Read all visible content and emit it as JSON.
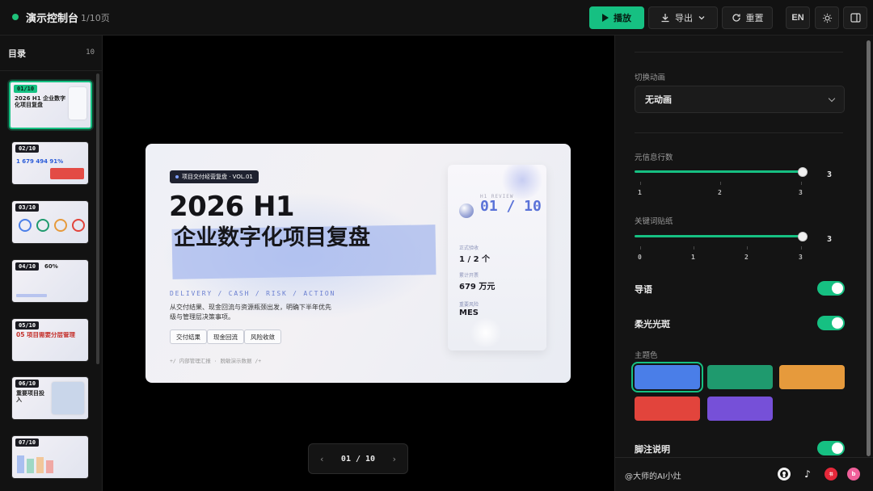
{
  "app": {
    "title": "演示控制台",
    "page_indicator": "1/10页"
  },
  "toolbar": {
    "play": "播放",
    "export": "导出",
    "reset": "重置",
    "lang": "EN"
  },
  "sidebar": {
    "title": "目录",
    "count": "10",
    "thumbnails": [
      {
        "badge": "01/10",
        "text": "2026 H1 企业数字化项目复盘"
      },
      {
        "badge": "02/10",
        "text": "1  679  494  91%"
      },
      {
        "badge": "03/10",
        "text": ""
      },
      {
        "badge": "04/10",
        "text": "60%"
      },
      {
        "badge": "05/10",
        "text": "05 项目需要分层管理"
      },
      {
        "badge": "06/10",
        "text": "重要项目投入"
      },
      {
        "badge": "07/10",
        "text": ""
      }
    ]
  },
  "slide": {
    "tag": "项目交付经营复盘 · VOL.01",
    "title_line1": "2026 H1",
    "title_line2": "企业数字化项目复盘",
    "subtitle_mono": "DELIVERY / CASH / RISK / ACTION",
    "description": "从交付结果、现金回流与资源瓶颈出发，明确下半年优先级与管理层决策事项。",
    "chips": [
      "交付结果",
      "现金回流",
      "风险收敛"
    ],
    "footer": "+/ 内部管理汇报 · 脱敏演示数据 /+",
    "card": {
      "kicker": "H1 REVIEW",
      "big_number": "01 / 10",
      "items": [
        {
          "label": "正式验收",
          "value": "1 / 2 个"
        },
        {
          "label": "累计开票",
          "value": "679 万元"
        },
        {
          "label": "重要风险",
          "value": "MES"
        }
      ]
    }
  },
  "pager": {
    "current": "01 / 10",
    "prev_icon": "chevron-left-icon",
    "next_icon": "chevron-right-icon"
  },
  "panel": {
    "transition": {
      "label": "切换动画",
      "value": "无动画"
    },
    "meta_rows": {
      "label": "元信息行数",
      "value": "3",
      "value_fraction": 1.0,
      "ticks": [
        "1",
        "2",
        "3"
      ]
    },
    "sticky_notes": {
      "label": "关键词贴纸",
      "value": "3",
      "value_fraction": 1.0,
      "ticks": [
        "0",
        "1",
        "2",
        "3"
      ]
    },
    "intro": {
      "label": "导语",
      "on": true
    },
    "soft_glow": {
      "label": "柔光光斑",
      "on": true
    },
    "theme": {
      "label": "主题色",
      "swatches": [
        "#4a7ee8",
        "#1f9a6e",
        "#e69a3c",
        "#e2443c",
        "#7650d8"
      ],
      "selected_index": 0
    },
    "footnote": {
      "label": "脚注说明",
      "on": true
    },
    "credit": "@大师的AI小灶",
    "social": [
      "github-icon",
      "tiktok-icon",
      "xiaohongshu-icon",
      "bilibili-icon"
    ]
  },
  "colors": {
    "accent": "#16c082",
    "background": "#0b0b0b"
  }
}
